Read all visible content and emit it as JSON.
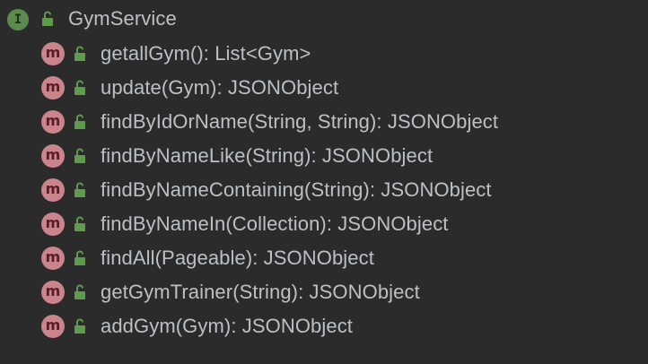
{
  "tree": {
    "interface": {
      "icon_letter": "I",
      "icon": "interface-icon",
      "name": "GymService"
    },
    "methods": [
      {
        "icon_letter": "m",
        "signature": "getallGym(): List<Gym>"
      },
      {
        "icon_letter": "m",
        "signature": "update(Gym): JSONObject"
      },
      {
        "icon_letter": "m",
        "signature": "findByIdOrName(String, String): JSONObject"
      },
      {
        "icon_letter": "m",
        "signature": "findByNameLike(String): JSONObject"
      },
      {
        "icon_letter": "m",
        "signature": "findByNameContaining(String): JSONObject"
      },
      {
        "icon_letter": "m",
        "signature": "findByNameIn(Collection): JSONObject"
      },
      {
        "icon_letter": "m",
        "signature": "findAll(Pageable): JSONObject"
      },
      {
        "icon_letter": "m",
        "signature": "getGymTrainer(String): JSONObject"
      },
      {
        "icon_letter": "m",
        "signature": "addGym(Gym): JSONObject"
      }
    ]
  },
  "colors": {
    "background": "#2b2b2c",
    "interface_icon": "#5c8a4c",
    "method_icon": "#c9848c",
    "public_lock": "#5f9a4f",
    "text": "#bcc0c4"
  }
}
